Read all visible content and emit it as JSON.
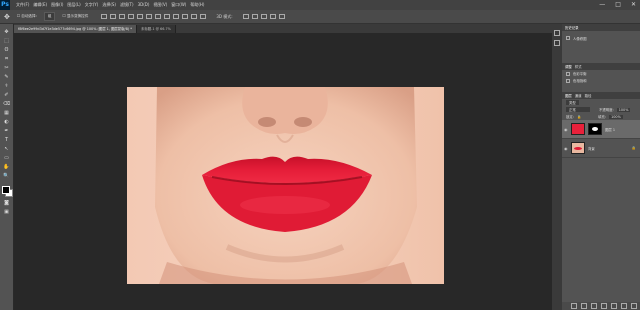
{
  "app": {
    "logo": "Ps"
  },
  "menu": [
    "文件(F)",
    "编辑(E)",
    "图像(I)",
    "图层(L)",
    "文字(Y)",
    "选择(S)",
    "滤镜(T)",
    "3D(D)",
    "视图(V)",
    "窗口(W)",
    "帮助(H)"
  ],
  "window_buttons": [
    "—",
    "□",
    "✕"
  ],
  "options": {
    "move_icon": "move-icon",
    "auto_select_label": "自动选择:",
    "auto_select_value": "组",
    "transform_label": "显示变换控件"
  },
  "tabs": [
    {
      "label": "f8f6ee2e99d3d7f1e3de577c6694.jpg @ 100% (图层 1, 图层蒙版/8) *",
      "active": true
    },
    {
      "label": "未标题-1 @ 66.7%",
      "active": false
    }
  ],
  "tools": [
    "✥",
    "⬚",
    "ʘ",
    "⌗",
    "✂",
    "✎",
    "⚕",
    "✐",
    "⌫",
    "▦",
    "◐",
    "✒",
    "T",
    "↖",
    "▭",
    "✋",
    "🔍"
  ],
  "panels": {
    "top_tab": "历史记录",
    "top_row": "人像修图",
    "second_header": [
      "调整",
      "样式"
    ],
    "second_rows": [
      "色彩平衡",
      "色相饱和"
    ],
    "layers_header": [
      "图层",
      "通道",
      "路径"
    ],
    "kind_label": "类型",
    "blend_mode": "正常",
    "opacity_label": "不透明度:",
    "opacity_value": "100%",
    "lock_label": "锁定:",
    "fill_label": "填充:",
    "fill_value": "100%",
    "layers": [
      {
        "name": "图层 1",
        "selected": true,
        "thumb_color": "#e8203a",
        "has_mask": true
      },
      {
        "name": "背景",
        "selected": false,
        "thumb_color": "#e9b8a0",
        "has_mask": false
      }
    ]
  },
  "colors": {
    "lip": "#e31b35",
    "skin": "#f0c9b2",
    "canvas_bg": "#282828"
  }
}
